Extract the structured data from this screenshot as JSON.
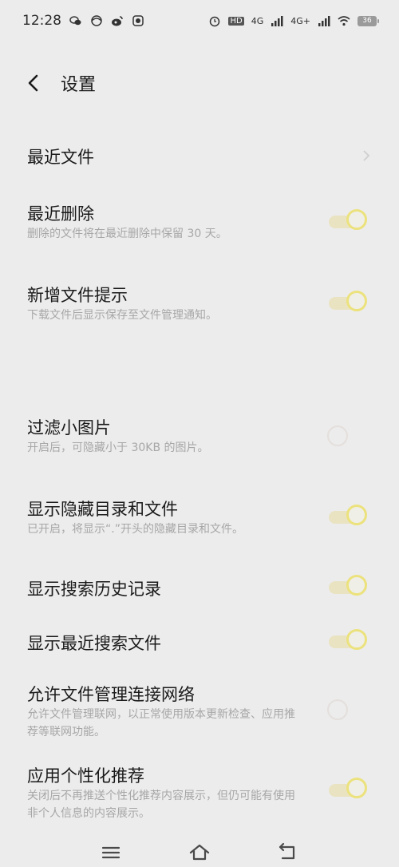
{
  "status_bar": {
    "time": "12:28",
    "battery": "36",
    "network_1": "4G",
    "network_2": "4G+",
    "hd": "HD"
  },
  "header": {
    "title": "设置"
  },
  "settings": [
    {
      "title": "最近文件",
      "desc": "",
      "control": "chevron"
    },
    {
      "title": "最近删除",
      "desc": "删除的文件将在最近删除中保留 30 天。",
      "control": "toggle",
      "on": true
    },
    {
      "title": "新增文件提示",
      "desc": "下载文件后显示保存至文件管理通知。",
      "control": "toggle",
      "on": true
    },
    {
      "title": "过滤小图片",
      "desc": "开启后，可隐藏小于 30KB 的图片。",
      "control": "toggle",
      "on": false
    },
    {
      "title": "显示隐藏目录和文件",
      "desc": "已开启，将显示“.”开头的隐藏目录和文件。",
      "control": "toggle",
      "on": true
    },
    {
      "title": "显示搜索历史记录",
      "desc": "",
      "control": "toggle",
      "on": true
    },
    {
      "title": "显示最近搜索文件",
      "desc": "",
      "control": "toggle",
      "on": true
    },
    {
      "title": "允许文件管理连接网络",
      "desc": "允许文件管理联网，以正常使用版本更新检查、应用推荐等联网功能。",
      "control": "toggle",
      "on": false
    },
    {
      "title": "应用个性化推荐",
      "desc": "关闭后不再推送个性化推荐内容展示，但仍可能有使用非个人信息的内容展示。",
      "control": "toggle",
      "on": true
    }
  ],
  "colors": {
    "background": "#ececec",
    "toggle_accent": "#ece27d"
  }
}
